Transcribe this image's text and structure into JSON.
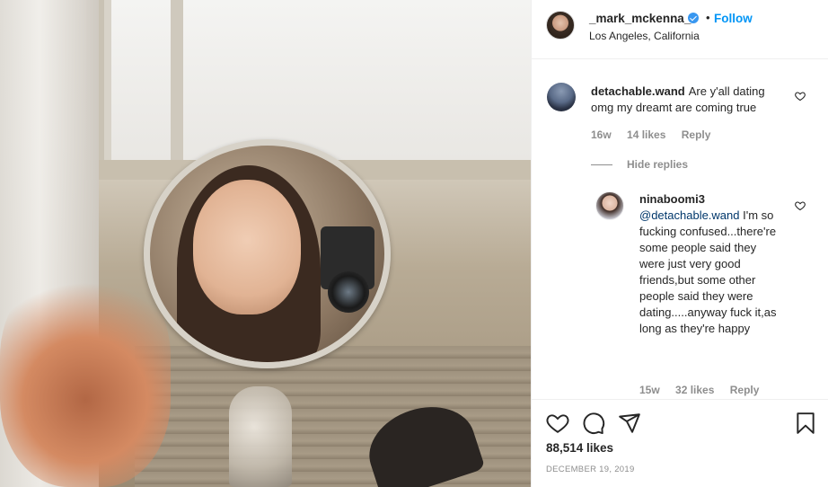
{
  "post": {
    "username": "_mark_mckenna_",
    "follow_label": "Follow",
    "separator": "•",
    "location": "Los Angeles, California"
  },
  "comments": [
    {
      "user": "detachable.wand",
      "text": "Are y'all dating omg my dreamt are coming true",
      "age": "16w",
      "likes": "14 likes",
      "reply_label": "Reply"
    },
    {
      "user": "ninaboomi3",
      "mention": "@detachable.wand",
      "text": "I'm so fucking confused...there're some people said they were just very good friends,but some other people said they were dating.....anyway fuck it,as long as they're happy",
      "age": "15w",
      "likes": "32 likes",
      "reply_label": "Reply"
    }
  ],
  "hide_replies_label": "Hide replies",
  "footer": {
    "likes": "88,514 likes",
    "date": "December 19, 2019"
  },
  "icons": {
    "verified": "verified-badge-icon",
    "comment_like": "heart-outline-icon",
    "like": "heart-outline-icon",
    "comment": "speech-bubble-icon",
    "share": "paper-plane-icon",
    "save": "bookmark-icon"
  },
  "colors": {
    "accent": "#0095f6",
    "verified": "#3897f0",
    "mention": "#00376b",
    "muted": "#8e8e8e"
  }
}
